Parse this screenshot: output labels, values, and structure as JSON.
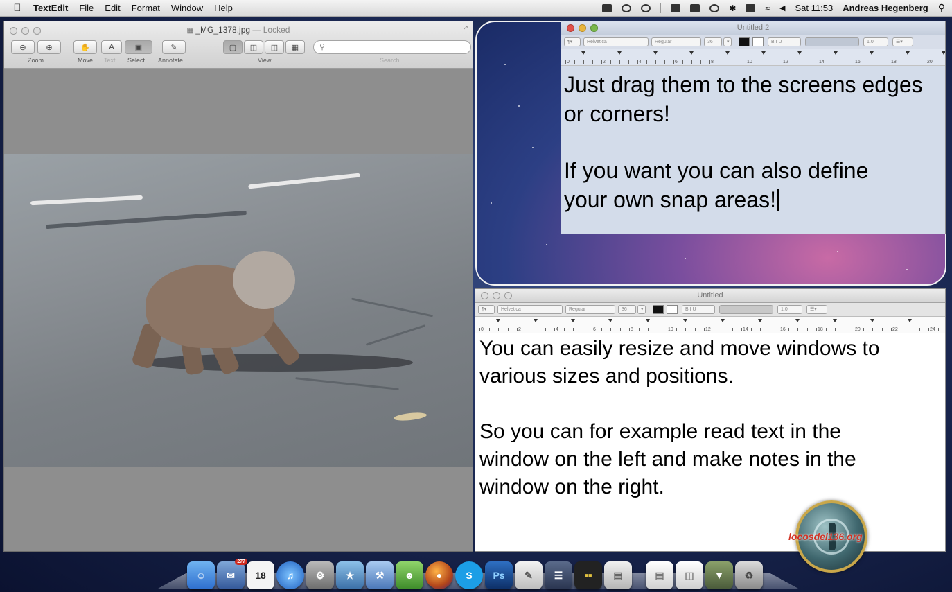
{
  "menubar": {
    "app_name": "TextEdit",
    "menus": [
      "File",
      "Edit",
      "Format",
      "Window",
      "Help"
    ],
    "clock": "Sat 11:53",
    "user": "Andreas Hegenberg"
  },
  "preview": {
    "title": "_MG_1378.jpg",
    "title_suffix": "— Locked",
    "toolbar_labels": {
      "zoom": "Zoom",
      "move": "Move",
      "text": "Text",
      "select": "Select",
      "annotate": "Annotate",
      "view": "View",
      "search": "Search"
    }
  },
  "textedit_top": {
    "title": "Untitled 2",
    "font": "Helvetica",
    "style": "Regular",
    "size": "36",
    "spacing": "1.0",
    "ruler_numbers": [
      "0",
      "2",
      "4",
      "6",
      "8",
      "10",
      "12",
      "14",
      "16",
      "18",
      "20"
    ],
    "line1": "Just drag them to the screens edges",
    "line2": "or corners!",
    "line3": "If you want you can also define",
    "line4": "your own snap areas!"
  },
  "textedit_bottom": {
    "title": "Untitled",
    "font": "Helvetica",
    "style": "Regular",
    "size": "36",
    "spacing": "1.0",
    "ruler_numbers": [
      "0",
      "2",
      "4",
      "6",
      "8",
      "10",
      "12",
      "14",
      "16",
      "18",
      "20",
      "22",
      "24"
    ],
    "line1": "You can easily resize and move windows to",
    "line2": "various sizes and positions.",
    "line3": "So you can for example read text in the",
    "line4": "window on the left and make notes in the",
    "line5": "window on the right."
  },
  "dock": {
    "calendar_day": "18",
    "skype_letter": "S",
    "photoshop_label": "Ps",
    "mail_badge": "277"
  },
  "watermark": "locosdel136.org",
  "colors": {
    "menubar": "#e6e6e6",
    "top_textedit_bg": "#d3dcea",
    "window_gray": "#8e8e8e",
    "watermark_red": "#d23325"
  }
}
